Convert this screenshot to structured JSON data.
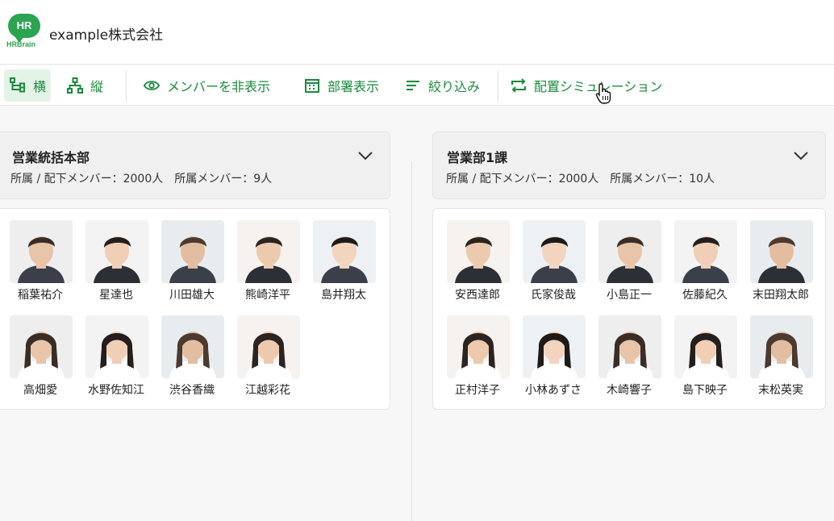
{
  "header": {
    "logo_text": "HR",
    "logo_sub": "HRBrain",
    "company": "example株式会社"
  },
  "toolbar": {
    "horizontal": "横",
    "vertical": "縦",
    "hide_members": "メンバーを非表示",
    "show_departments": "部署表示",
    "filter": "絞り込み",
    "simulation": "配置シミュレーション"
  },
  "departments": [
    {
      "name": "営業統括本部",
      "stats": "所属 / 配下メンバー：2000人　所属メンバー：9人",
      "members": [
        "稲葉祐介",
        "星達也",
        "川田雄大",
        "熊崎洋平",
        "島井翔太",
        "高畑愛",
        "水野佐知江",
        "渋谷香織",
        "江越彩花"
      ]
    },
    {
      "name": "営業部1課",
      "stats": "所属 / 配下メンバー：2000人　所属メンバー：10人",
      "members": [
        "安西達郎",
        "氏家俊哉",
        "小島正一",
        "佐藤紀久",
        "末田翔太郎",
        "正村洋子",
        "小林あずさ",
        "木崎響子",
        "島下映子",
        "末松英実"
      ]
    }
  ],
  "colors": {
    "accent": "#1a8a3c",
    "active_bg": "#e4f3e8"
  }
}
